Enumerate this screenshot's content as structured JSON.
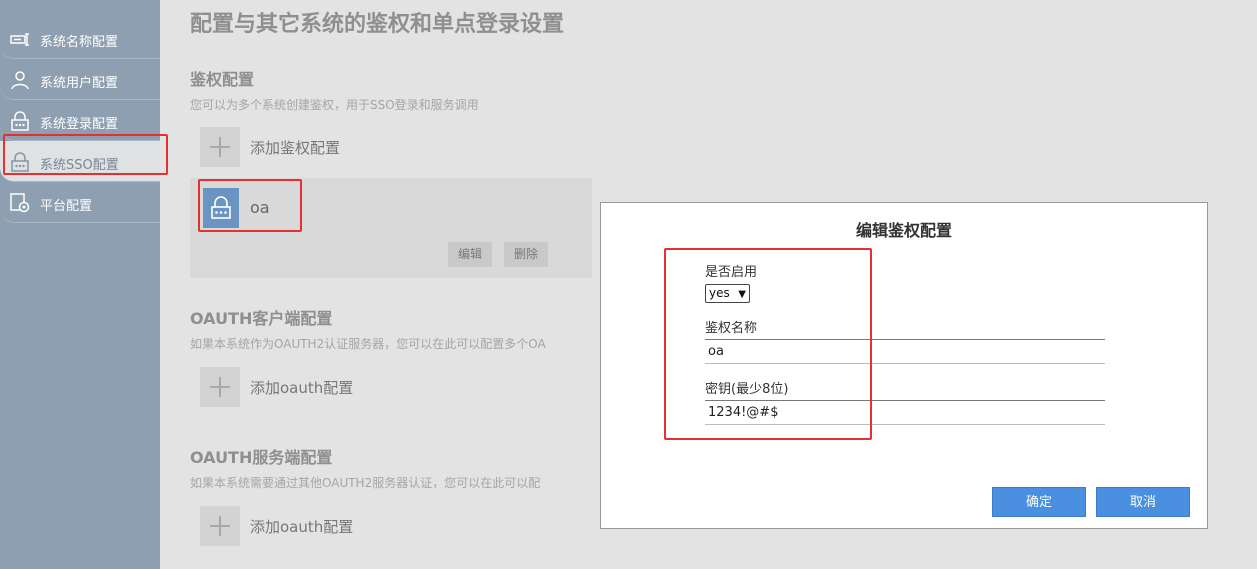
{
  "sidebar": {
    "items": [
      {
        "label": "系统名称配置",
        "icon": "name-tag-icon"
      },
      {
        "label": "系统用户配置",
        "icon": "user-icon"
      },
      {
        "label": "系统登录配置",
        "icon": "lock-icon"
      },
      {
        "label": "系统SSO配置",
        "icon": "lock-icon"
      },
      {
        "label": "平台配置",
        "icon": "platform-settings-icon"
      }
    ]
  },
  "page": {
    "title": "配置与其它系统的鉴权和单点登录设置"
  },
  "auth_section": {
    "title": "鉴权配置",
    "desc": "您可以为多个系统创建鉴权，用于SSO登录和服务调用",
    "add_label": "添加鉴权配置",
    "items": [
      {
        "name": "oa",
        "edit_label": "编辑",
        "delete_label": "删除"
      }
    ]
  },
  "oauth_client": {
    "title": "OAUTH客户端配置",
    "desc": "如果本系统作为OAUTH2认证服务器，您可以在此可以配置多个OA",
    "add_label": "添加oauth配置"
  },
  "oauth_server": {
    "title": "OAUTH服务端配置",
    "desc": "如果本系统需要通过其他OAUTH2服务器认证，您可以在此可以配",
    "add_label": "添加oauth配置"
  },
  "modal": {
    "title": "编辑鉴权配置",
    "enabled_label": "是否启用",
    "enabled_value": "yes",
    "name_label": "鉴权名称",
    "name_value": "oa",
    "key_label": "密钥(最少8位)",
    "key_value": "1234!@#$",
    "ok_label": "确定",
    "cancel_label": "取消"
  },
  "colors": {
    "sidebar": "#8d9fb1",
    "accent": "#4a8fe0",
    "highlight": "#e43030"
  }
}
